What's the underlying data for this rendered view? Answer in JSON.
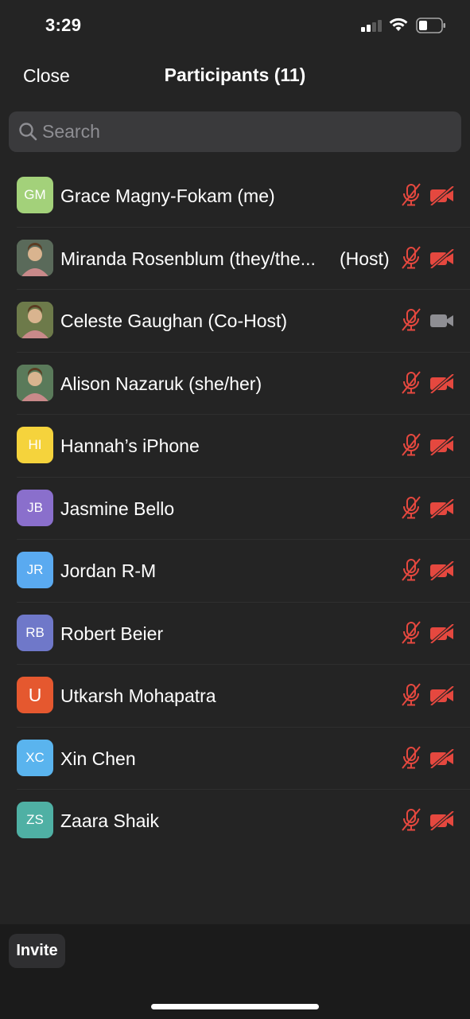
{
  "status": {
    "time": "3:29"
  },
  "header": {
    "close_label": "Close",
    "title": "Participants (11)"
  },
  "search": {
    "placeholder": "Search",
    "value": ""
  },
  "colors": {
    "muted_red": "#e5483f",
    "camera_on_gray": "#8e8e93"
  },
  "participants": [
    {
      "name": "Grace Magny-Fokam (me)",
      "role": "",
      "initials": "GM",
      "avatar_color": "#a3d17a",
      "avatar_type": "initials",
      "audio": "muted",
      "video": "off"
    },
    {
      "name": "Miranda Rosenblum (they/the...",
      "role": "(Host)",
      "initials": "",
      "avatar_color": "#5a6a5a",
      "avatar_type": "photo",
      "audio": "muted",
      "video": "off"
    },
    {
      "name": "Celeste Gaughan (Co-Host)",
      "role": "",
      "initials": "",
      "avatar_color": "#6d7a4a",
      "avatar_type": "photo",
      "audio": "muted",
      "video": "on"
    },
    {
      "name": "Alison Nazaruk (she/her)",
      "role": "",
      "initials": "",
      "avatar_color": "#5a7a5a",
      "avatar_type": "photo",
      "audio": "muted",
      "video": "off"
    },
    {
      "name": "Hannah’s iPhone",
      "role": "",
      "initials": "HI",
      "avatar_color": "#f5d33c",
      "avatar_type": "initials",
      "audio": "muted",
      "video": "off"
    },
    {
      "name": "Jasmine Bello",
      "role": "",
      "initials": "JB",
      "avatar_color": "#8a6fcc",
      "avatar_type": "initials",
      "audio": "muted",
      "video": "off"
    },
    {
      "name": "Jordan R-M",
      "role": "",
      "initials": "JR",
      "avatar_color": "#5aaaf0",
      "avatar_type": "initials",
      "audio": "muted",
      "video": "off"
    },
    {
      "name": "Robert Beier",
      "role": "",
      "initials": "RB",
      "avatar_color": "#6f78c9",
      "avatar_type": "initials",
      "audio": "muted",
      "video": "off"
    },
    {
      "name": "Utkarsh Mohapatra",
      "role": "",
      "initials": "U",
      "avatar_color": "#e5582f",
      "avatar_type": "initials",
      "audio": "muted",
      "video": "off"
    },
    {
      "name": "Xin Chen",
      "role": "",
      "initials": "XC",
      "avatar_color": "#5ab4ee",
      "avatar_type": "initials",
      "audio": "muted",
      "video": "off"
    },
    {
      "name": "Zaara Shaik",
      "role": "",
      "initials": "ZS",
      "avatar_color": "#4fb0a4",
      "avatar_type": "initials",
      "audio": "muted",
      "video": "off"
    }
  ],
  "footer": {
    "invite_label": "Invite"
  }
}
